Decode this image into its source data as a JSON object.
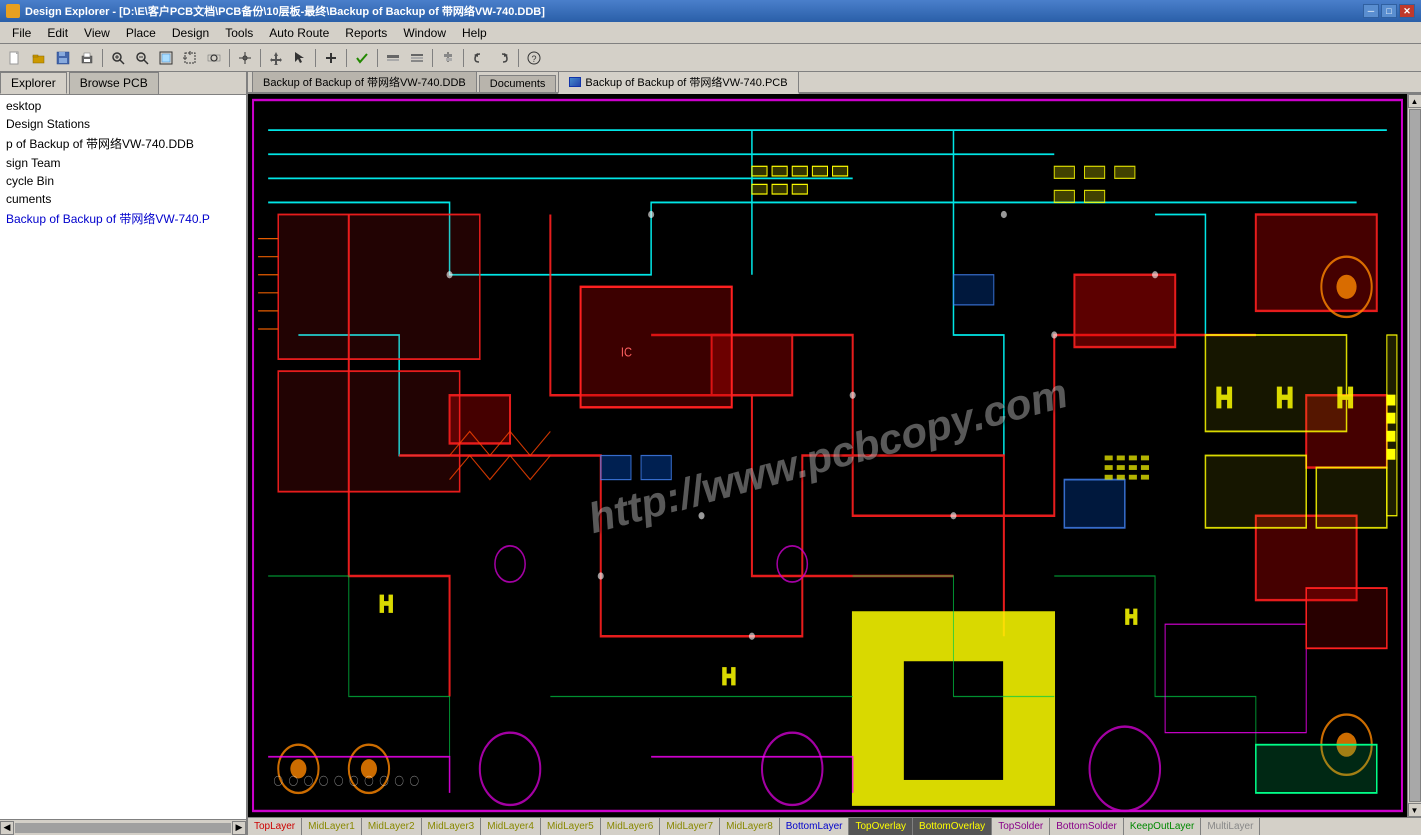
{
  "titleBar": {
    "appName": "Design Explorer",
    "filePath": "[D:\\E\\客户PCB文档\\PCB备份\\10层板-最终\\Backup of Backup of 带网络VW-740.DDB]",
    "fullTitle": "Design Explorer - [D:\\E\\客户PCB文档\\PCB备份\\10层板-最终\\Backup of Backup of 带网络VW-740.DDB]",
    "minBtn": "─",
    "maxBtn": "□",
    "closeBtn": "✕"
  },
  "menuBar": {
    "items": [
      "File",
      "Edit",
      "View",
      "Place",
      "Design",
      "Tools",
      "Auto Route",
      "Reports",
      "Window",
      "Help"
    ]
  },
  "toolbar": {
    "buttons": [
      "new",
      "open",
      "save",
      "print",
      "sep",
      "zoom-in",
      "zoom-out",
      "zoom-fit",
      "zoom-area",
      "sep",
      "cross",
      "sep",
      "move",
      "select",
      "sep",
      "add",
      "sep",
      "check",
      "sep",
      "route1",
      "route2",
      "sep",
      "align",
      "sep",
      "undo",
      "redo",
      "sep",
      "help"
    ]
  },
  "leftPanel": {
    "tabs": [
      "Explorer",
      "Browse PCB"
    ],
    "activeTab": "Explorer",
    "treeItems": [
      {
        "label": "esktop",
        "type": "normal"
      },
      {
        "label": "Design Stations",
        "type": "normal"
      },
      {
        "label": "p of Backup of 带网络VW-740.DDB",
        "type": "normal"
      },
      {
        "label": "sign Team",
        "type": "normal"
      },
      {
        "label": "cycle Bin",
        "type": "normal"
      },
      {
        "label": "cuments",
        "type": "normal"
      },
      {
        "label": "Backup of Backup of 带网络VW-740.P",
        "type": "highlight"
      }
    ]
  },
  "docTabs": [
    {
      "label": "Backup of Backup of 带网络VW-740.DDB",
      "hasIcon": false,
      "active": false
    },
    {
      "label": "Documents",
      "hasIcon": false,
      "active": false
    },
    {
      "label": "Backup of Backup of 带网络VW-740.PCB",
      "hasIcon": true,
      "active": true
    }
  ],
  "pcb": {
    "watermark": "http://www.pcbcopy.com",
    "background": "#000000"
  },
  "layerTabs": [
    {
      "label": "TopLayer",
      "class": "top"
    },
    {
      "label": "MidLayer1",
      "class": "mid"
    },
    {
      "label": "MidLayer2",
      "class": "mid"
    },
    {
      "label": "MidLayer3",
      "class": "mid"
    },
    {
      "label": "MidLayer4",
      "class": "mid"
    },
    {
      "label": "MidLayer5",
      "class": "mid"
    },
    {
      "label": "MidLayer6",
      "class": "mid"
    },
    {
      "label": "MidLayer7",
      "class": "mid"
    },
    {
      "label": "MidLayer8",
      "class": "mid"
    },
    {
      "label": "BottomLayer",
      "class": "bottom"
    },
    {
      "label": "TopOverlay",
      "class": "overlay"
    },
    {
      "label": "BottomOverlay",
      "class": "overlay"
    },
    {
      "label": "TopSolder",
      "class": "solder"
    },
    {
      "label": "BottomSolder",
      "class": "solder"
    },
    {
      "label": "KeepOutLayer",
      "class": "keep"
    },
    {
      "label": "MultiLayer",
      "class": "multi"
    }
  ],
  "icons": {
    "new": "📄",
    "open": "📂",
    "save": "💾",
    "print": "🖨",
    "zoomIn": "🔍",
    "zoomOut": "🔎",
    "undo": "↩",
    "redo": "↪",
    "help": "?"
  }
}
